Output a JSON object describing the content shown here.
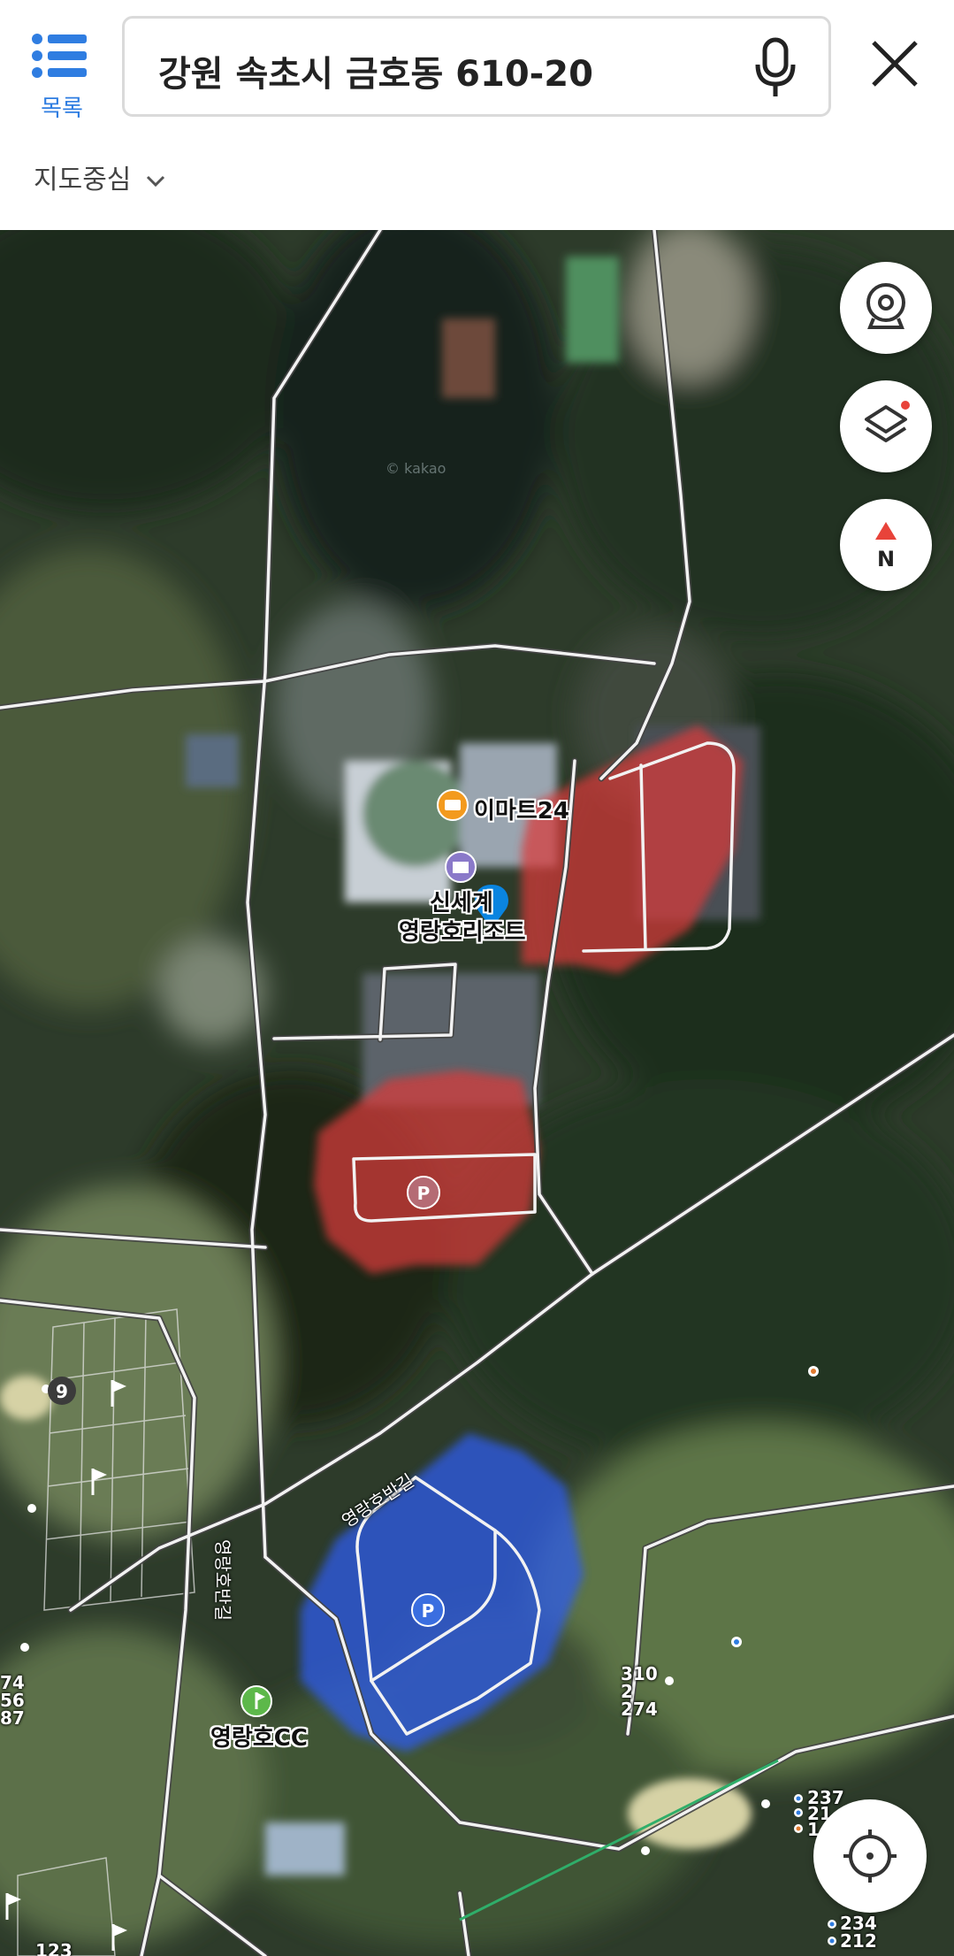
{
  "header": {
    "menu_label": "목록",
    "search_query": "강원 속초시 금호동 610-20",
    "map_center_label": "지도중심"
  },
  "map": {
    "pois": {
      "emart": "이마트24",
      "resort_line1": "신세계",
      "resort_line2": "영랑호리조트",
      "golf": "영랑호CC",
      "green_number": "9"
    },
    "roads": {
      "vertical": "영랑호반길",
      "diagonal": "영랑호반길"
    },
    "parking_symbol": "P",
    "compass_letter": "N",
    "hole_numbers": {
      "mid": [
        "310",
        "2",
        "274"
      ],
      "right": [
        "237",
        "21",
        "1"
      ],
      "bottom_right": [
        "234",
        "212"
      ],
      "left": [
        "74",
        "56",
        "87"
      ],
      "bottom_left": "123"
    },
    "watermark": "© kakao",
    "colors": {
      "red_zone": "#d93a3a",
      "blue_zone": "#2f5bea",
      "marker": "#0a84e0",
      "accent": "#2f7de1"
    }
  }
}
